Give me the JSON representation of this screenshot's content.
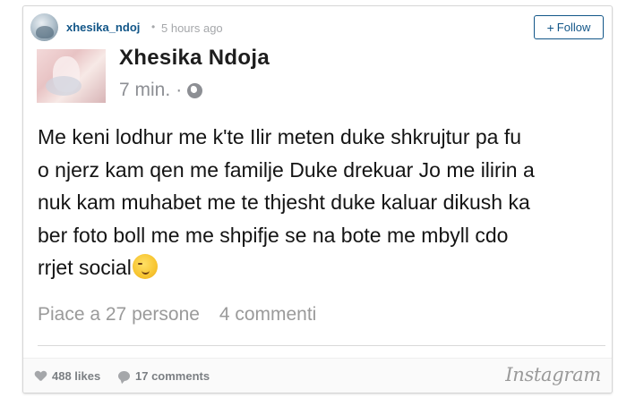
{
  "header": {
    "username": "xhesika_ndoj",
    "separator": "•",
    "timestamp": "5 hours ago",
    "follow_label": "Follow",
    "follow_icon": "plus-icon"
  },
  "post": {
    "fb_name": "Xhesika Ndoja",
    "fb_time": "7 min.",
    "fb_separator": "·",
    "fb_privacy_icon": "globe-icon",
    "text_lines": [
      "Me keni lodhur me k'te Ilir meten duke shkrujtur pa fu",
      "o njerz kam qen me familje Duke drekuar Jo me ilirin a",
      "nuk kam muhabet me te thjesht duke kaluar dikush ka",
      "ber foto boll me me shpifje se na bote me mbyll cdo",
      "rrjet social"
    ],
    "emoji": "wink-emoji",
    "fb_likes": "Piace a 27 persone",
    "fb_comments": "4 commenti"
  },
  "footer": {
    "likes": "488 likes",
    "comments": "17 comments",
    "brand": "Instagram"
  },
  "colors": {
    "link": "#125688",
    "muted": "#a5a7aa",
    "text": "#141414"
  }
}
